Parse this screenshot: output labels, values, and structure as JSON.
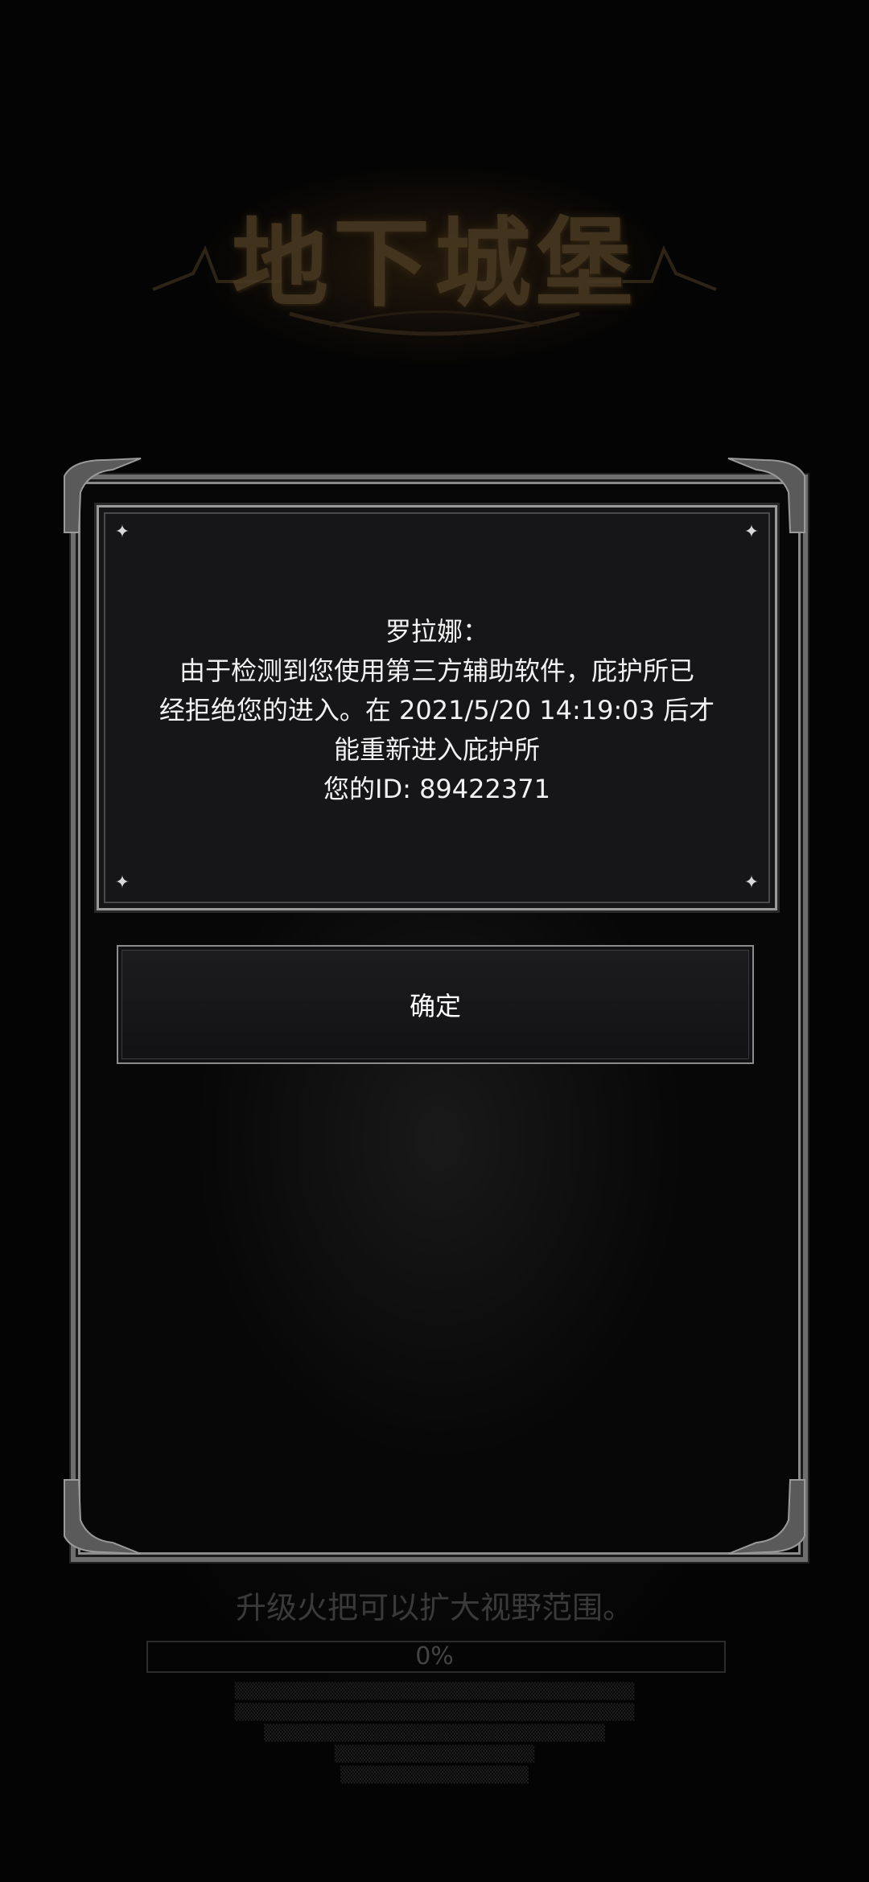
{
  "game": {
    "logo_text": "地下城堡"
  },
  "dialog": {
    "speaker": "罗拉娜：",
    "lines": [
      "由于检测到您使用第三方辅助软件，庇护所已",
      "经拒绝您的进入。在 2021/5/20 14:19:03 后才",
      "能重新进入庇护所",
      "您的ID: 89422371"
    ],
    "confirm_label": "确定"
  },
  "loading": {
    "tip": "升级火把可以扩大视野范围。",
    "progress_label": "0%",
    "progress_fraction": 0
  },
  "colors": {
    "frame": "#6e6e6e",
    "dialog_bg": "#161618",
    "text": "#f2f2f2",
    "logo": "#4a3a22"
  }
}
